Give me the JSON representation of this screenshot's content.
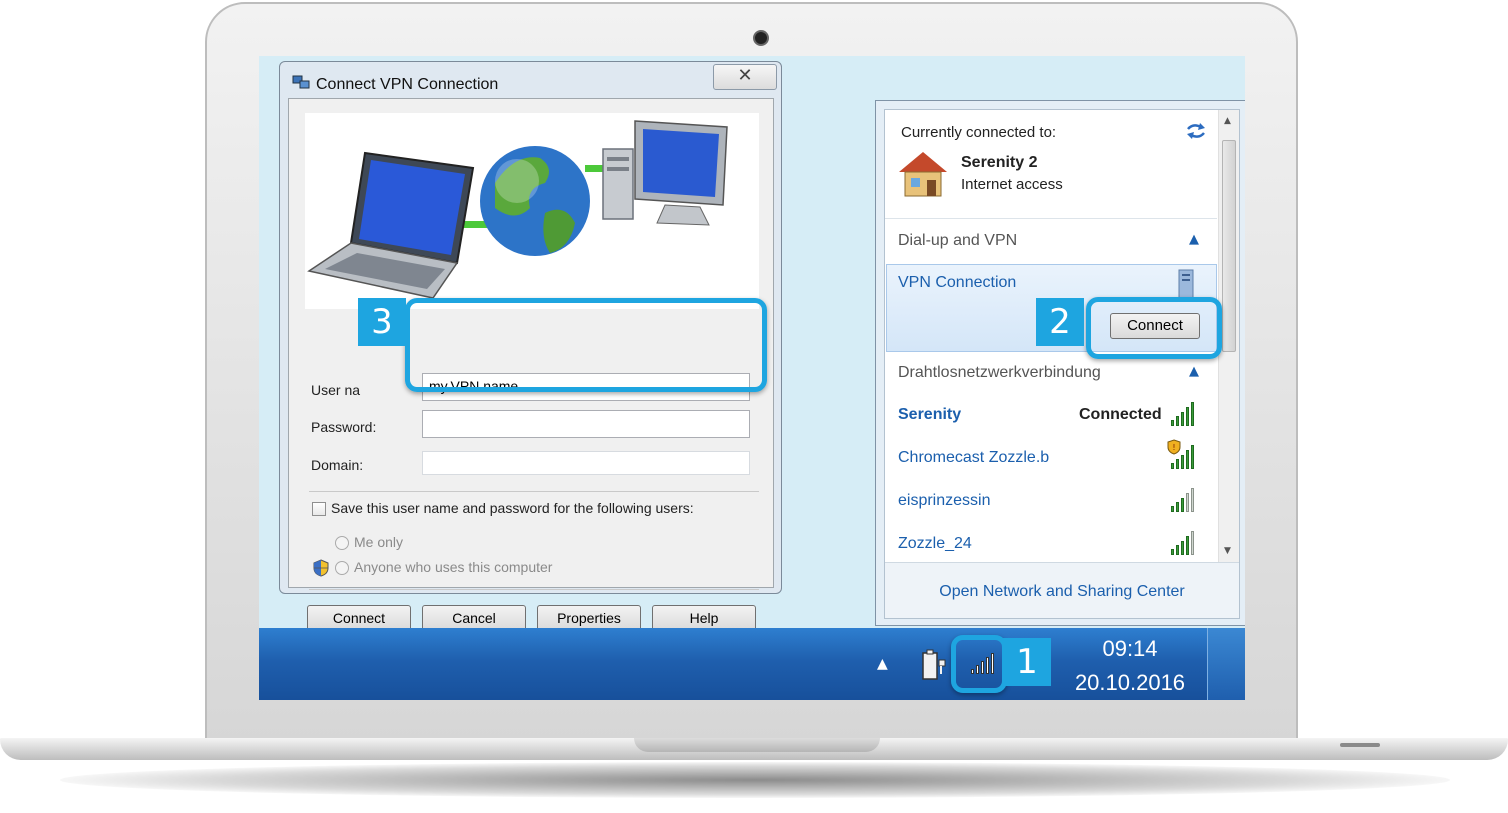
{
  "dialog": {
    "title": "Connect VPN Connection",
    "close_symbol": "✕",
    "username_label": "User na",
    "username_value": "my.VPN.name",
    "password_label": "Password:",
    "password_value": "",
    "domain_label": "Domain:",
    "domain_value": "",
    "save_label": "Save this user name and password for the following users:",
    "me_only": "Me only",
    "anyone": "Anyone who uses this computer",
    "buttons": {
      "connect": "Connect",
      "cancel": "Cancel",
      "properties": "Properties",
      "help": "Help"
    }
  },
  "network": {
    "connected_to_label": "Currently connected to:",
    "current_network": "Serenity  2",
    "current_status": "Internet access",
    "dialup_header": "Dial-up and VPN",
    "vpn_name": "VPN Connection",
    "vpn_connect_label": "Connect",
    "wireless_header": "Drahtlosnetzwerkverbindung",
    "networks": [
      {
        "name": "Serenity",
        "status": "Connected",
        "bold": true
      },
      {
        "name": "Chromecast Zozzle.b",
        "status": ""
      },
      {
        "name": "eisprinzessin",
        "status": ""
      },
      {
        "name": "Zozzle_24",
        "status": ""
      }
    ],
    "footer_link": "Open Network and Sharing Center"
  },
  "taskbar": {
    "time": "09:14",
    "date": "20.10.2016",
    "tray_up_symbol": "▲"
  },
  "callouts": {
    "one": "1",
    "two": "2",
    "three": "3"
  },
  "colors": {
    "accent": "#1ea5e0",
    "taskbar": "#1f5fae",
    "link": "#1b5fad"
  }
}
